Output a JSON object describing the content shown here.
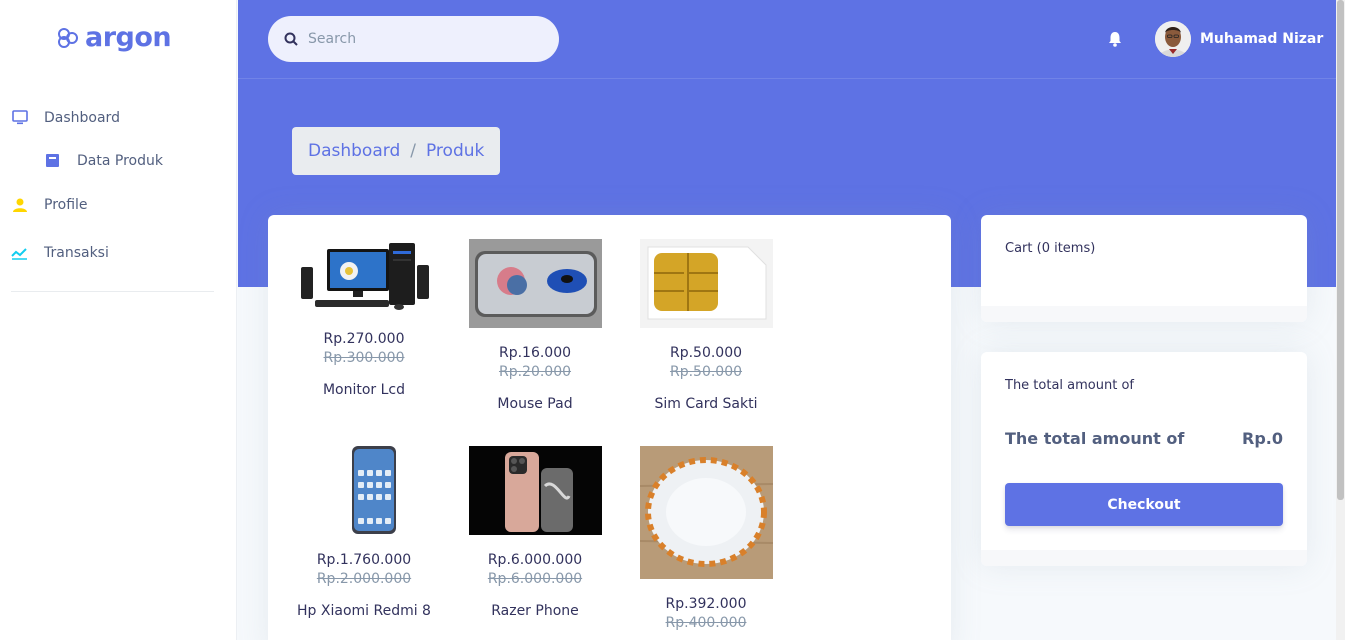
{
  "brand": {
    "name": "argon",
    "color": "#5e72e4",
    "icon": "argon-logo-icon"
  },
  "sidebar": {
    "items": [
      {
        "label": "Dashboard",
        "icon": "monitor-icon"
      },
      {
        "label": "Data Produk",
        "icon": "archive-box-icon"
      },
      {
        "label": "Profile",
        "icon": "user-icon"
      },
      {
        "label": "Transaksi",
        "icon": "chart-line-icon"
      }
    ]
  },
  "header": {
    "search": {
      "placeholder": "Search",
      "icon": "search-icon"
    },
    "notification_icon": "bell-icon",
    "user": {
      "name": "Muhamad Nizar",
      "avatar": "avatar"
    }
  },
  "breadcrumb": [
    "Dashboard",
    "Produk"
  ],
  "products": [
    {
      "price": "Rp.270.000",
      "old_price": "Rp.300.000",
      "name": "Monitor Lcd"
    },
    {
      "price": "Rp.16.000",
      "old_price": "Rp.20.000",
      "name": "Mouse Pad"
    },
    {
      "price": "Rp.50.000",
      "old_price": "Rp.50.000",
      "name": "Sim Card Sakti"
    },
    {
      "price": "Rp.1.760.000",
      "old_price": "Rp.2.000.000",
      "name": "Hp Xiaomi Redmi 8"
    },
    {
      "price": "Rp.6.000.000",
      "old_price": "Rp.6.000.000",
      "name": "Razer Phone"
    },
    {
      "price": "Rp.392.000",
      "old_price": "Rp.400.000",
      "name": ""
    }
  ],
  "cart": {
    "title": "Cart (0 items)"
  },
  "total": {
    "label_small": "The total amount of",
    "label_big": "The total amount of",
    "amount": "Rp.0",
    "checkout_label": "Checkout"
  },
  "colors": {
    "primary": "#5e72e4",
    "profile_icon": "#ffd600",
    "transaksi_icon": "#11cdef"
  }
}
